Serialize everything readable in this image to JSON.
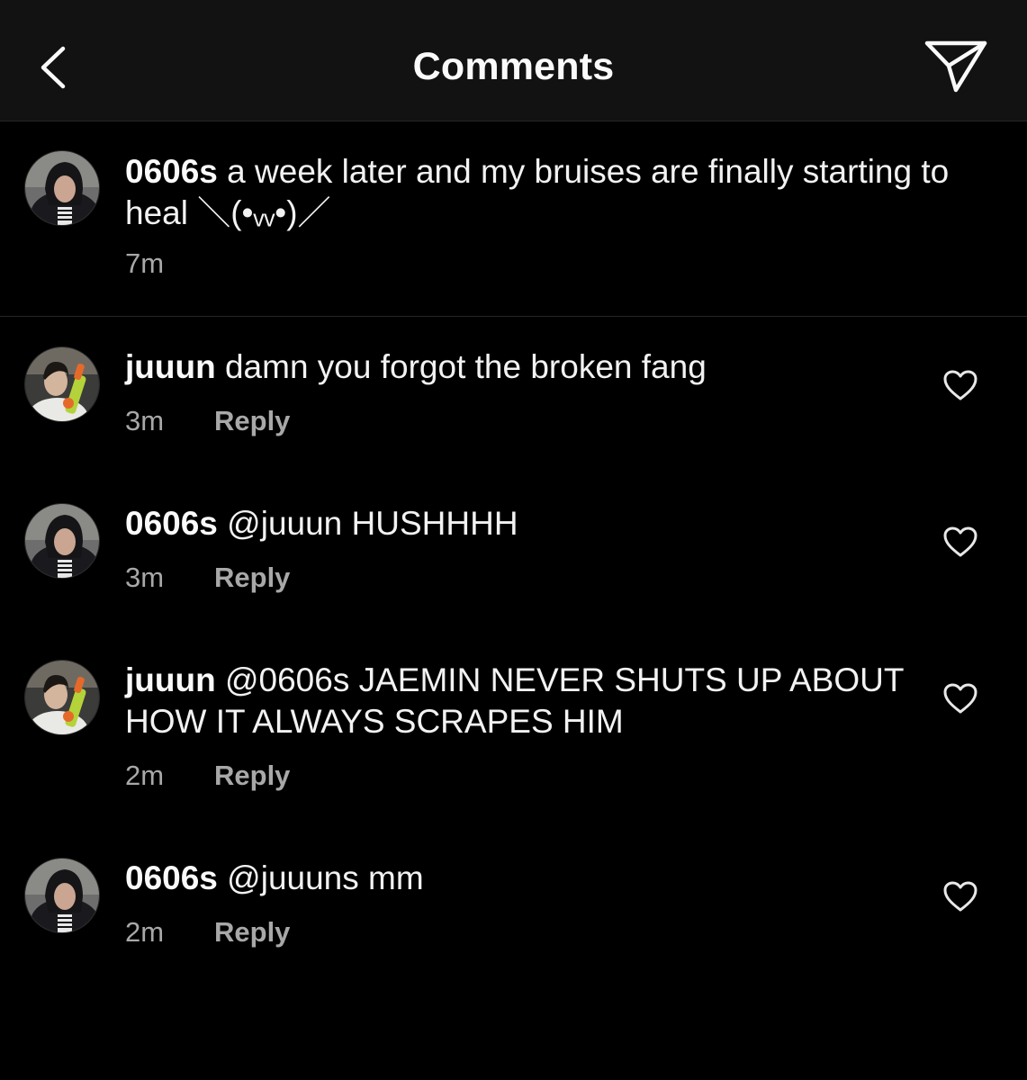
{
  "header": {
    "title": "Comments",
    "back_icon": "chevron-left-icon",
    "share_icon": "paper-plane-icon"
  },
  "colors": {
    "background": "#000000",
    "header_background": "#121212",
    "text_primary": "#f5f5f5",
    "text_secondary": "#a8a8a8",
    "divider": "#262626"
  },
  "caption": {
    "username": "0606s",
    "text": " a week later and my bruises are finally starting to heal ＼(•ᵥᵥ•)／",
    "time": "7m"
  },
  "comments": [
    {
      "username": "juuun",
      "text": " damn you forgot the broken fang",
      "time": "3m",
      "reply_label": "Reply"
    },
    {
      "username": "0606s",
      "text": " @juuun HUSHHHH",
      "time": "3m",
      "reply_label": "Reply"
    },
    {
      "username": "juuun",
      "text": " @0606s JAEMIN NEVER SHUTS UP ABOUT HOW IT ALWAYS SCRAPES HIM",
      "time": "2m",
      "reply_label": "Reply"
    },
    {
      "username": "0606s",
      "text": " @juuuns mm",
      "time": "2m",
      "reply_label": "Reply"
    }
  ]
}
